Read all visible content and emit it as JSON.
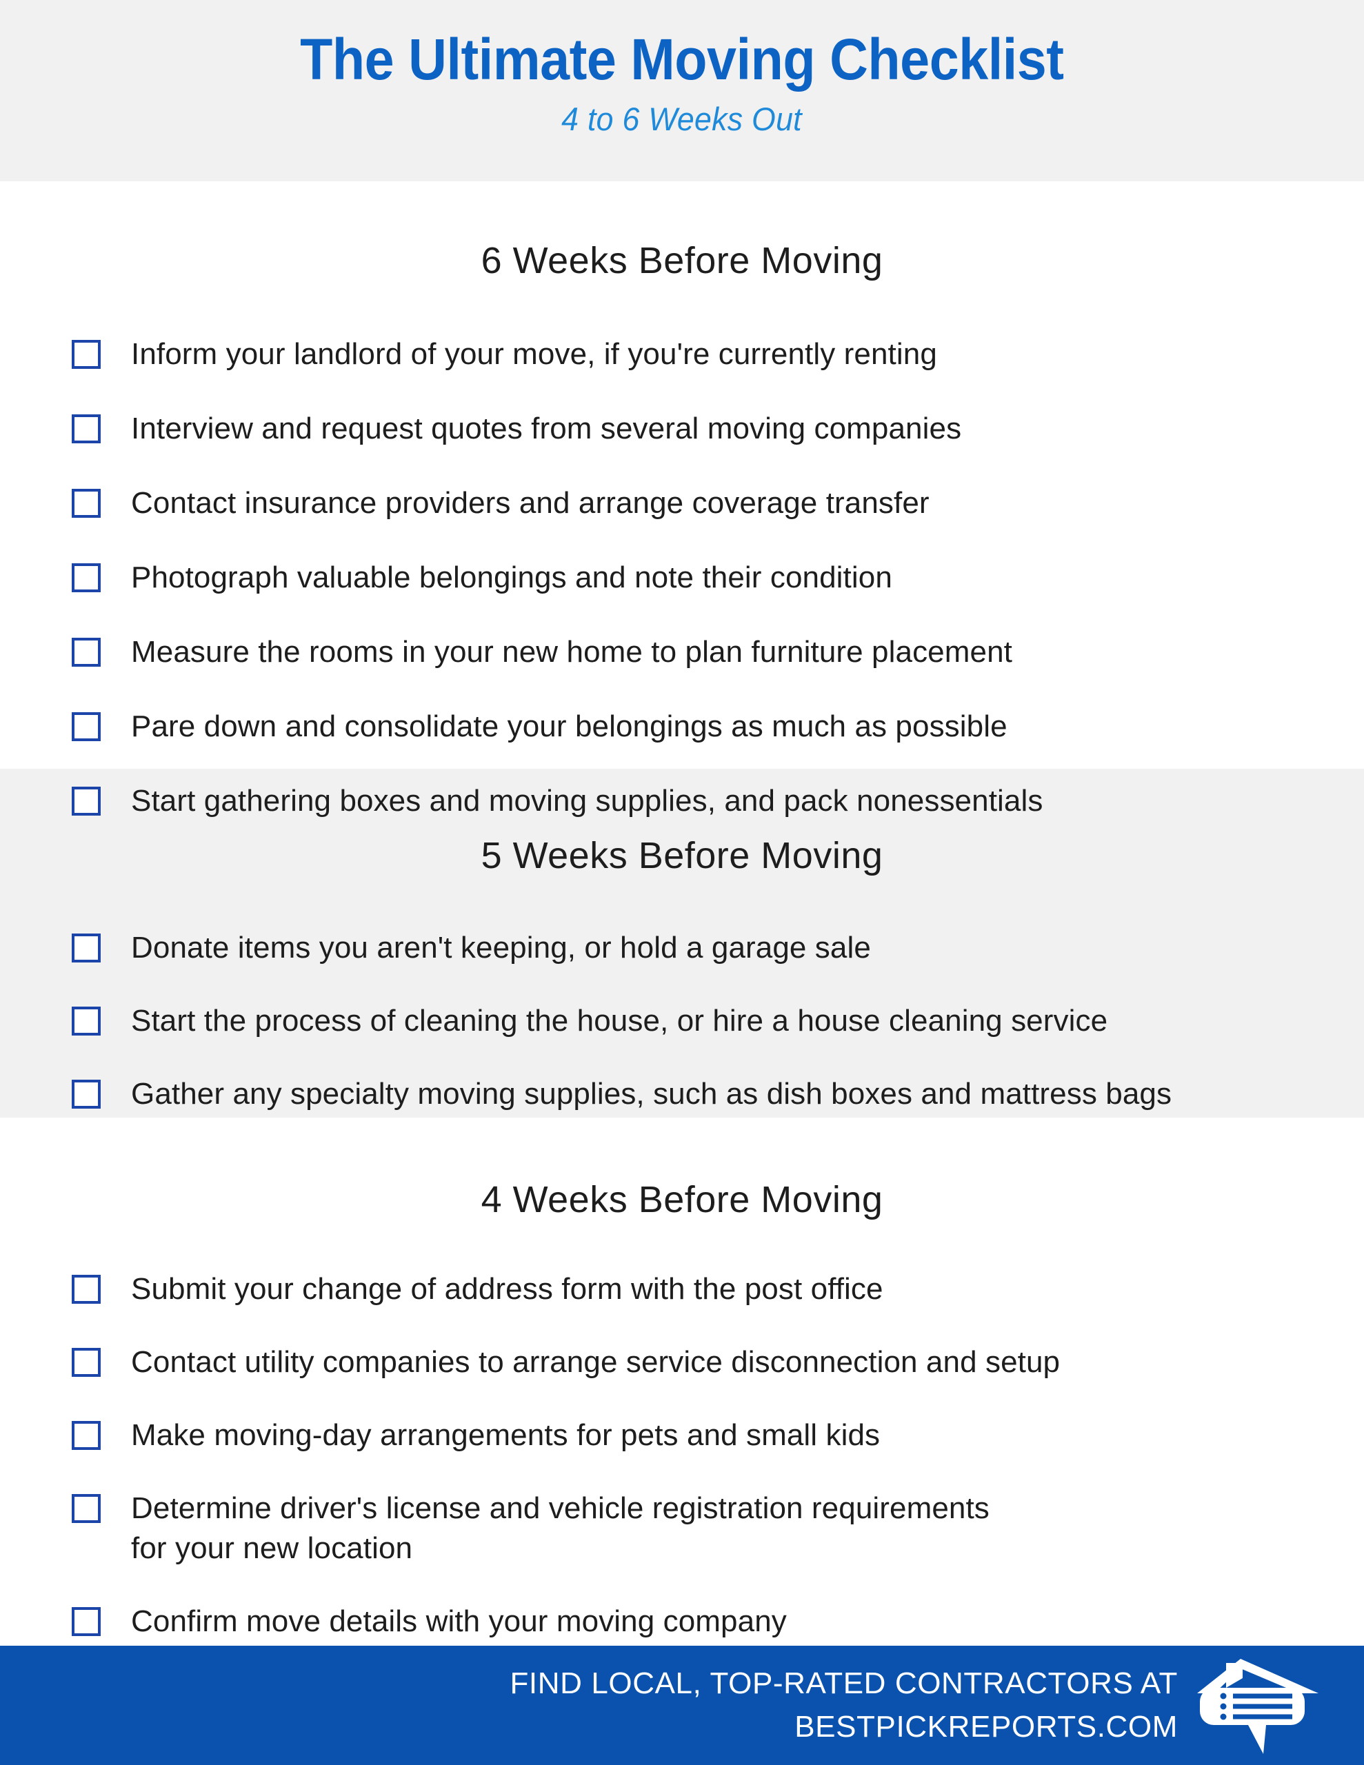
{
  "header": {
    "title": "The Ultimate Moving Checklist",
    "subtitle": "4 to 6 Weeks Out",
    "title_color": "#0d63c4",
    "subtitle_color": "#1e8ad9",
    "background_color": "#f1f1f1"
  },
  "sections": [
    {
      "title": "6 Weeks Before Moving",
      "shaded": false,
      "items": [
        "Inform your landlord of your move, if you're currently renting",
        "Interview and request quotes from several moving companies",
        "Contact insurance providers and arrange coverage transfer",
        "Photograph valuable belongings and note their condition",
        "Measure the rooms in your new home to plan furniture placement",
        "Pare down and consolidate your belongings as much as possible",
        "Start gathering boxes and moving supplies, and pack nonessentials"
      ]
    },
    {
      "title": "5 Weeks Before Moving",
      "shaded": true,
      "items": [
        "Donate items you aren't keeping, or hold a garage sale",
        "Start the process of cleaning the house, or hire a house cleaning service",
        "Gather any specialty moving supplies, such as dish boxes and mattress bags"
      ]
    },
    {
      "title": "4 Weeks Before Moving",
      "shaded": false,
      "items": [
        "Submit your change of address form with the post office",
        "Contact utility companies to arrange service disconnection and setup",
        "Make moving-day arrangements for pets and small kids",
        "Determine driver's license and vehicle registration requirements\nfor your new location",
        "Confirm move details with your moving company"
      ]
    }
  ],
  "footer": {
    "line1": "FIND LOCAL, TOP-RATED CONTRACTORS AT",
    "line2": "BESTPICKREPORTS.COM",
    "text": "FIND LOCAL, TOP-RATED CONTRACTORS AT\nBESTPICKREPORTS.COM",
    "logo_name": "best-pick-reports-house-logo",
    "background_color": "#0a52ad",
    "text_color": "#ffffff"
  },
  "checkbox": {
    "border_color": "#1b45a8",
    "fill_color": "#ffffff",
    "checked": false
  }
}
